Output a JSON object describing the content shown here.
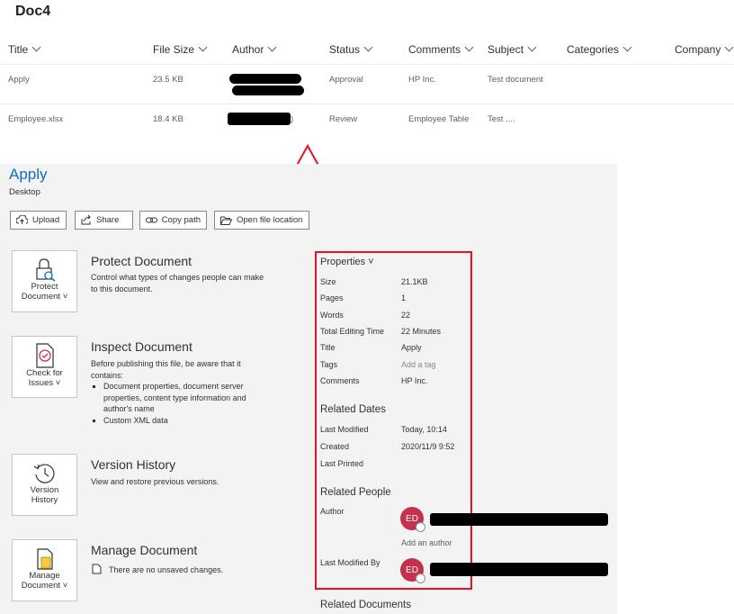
{
  "doc_title": "Doc4",
  "columns": [
    "Title",
    "File Size",
    "Author",
    "Status",
    "Comments",
    "Subject",
    "Categories",
    "Company"
  ],
  "rows": [
    {
      "title": "Apply",
      "size": "23.5 KB",
      "status": "Approval",
      "comments": "HP Inc.",
      "subject": "Test document"
    },
    {
      "title": "Employee.xlsx",
      "size": "18.4 KB",
      "author_tail": ")",
      "status": "Review",
      "comments": "Employee Table",
      "subject": "Test ...."
    }
  ],
  "info": {
    "title": "Apply",
    "location": "Desktop",
    "buttons": {
      "upload": "Upload",
      "share": "Share",
      "copy_path": "Copy path",
      "open_location": "Open file location"
    }
  },
  "sections": {
    "protect": {
      "tile_line1": "Protect",
      "tile_line2": "Document",
      "heading": "Protect Document",
      "desc": "Control what types of changes people can make to this document."
    },
    "inspect": {
      "tile_line1": "Check for",
      "tile_line2": "Issues",
      "heading": "Inspect Document",
      "desc": "Before publishing this file, be aware that it contains:",
      "bullets": [
        "Document properties, document server properties, content type information and author's name",
        "Custom XML data"
      ]
    },
    "version": {
      "tile_line1": "Version",
      "tile_line2": "History",
      "heading": "Version History",
      "desc": "View and restore previous versions."
    },
    "manage": {
      "tile_line1": "Manage",
      "tile_line2": "Document",
      "heading": "Manage Document",
      "desc": "There are no unsaved changes."
    }
  },
  "properties": {
    "heading": "Properties",
    "items": [
      {
        "label": "Size",
        "value": "21.1KB"
      },
      {
        "label": "Pages",
        "value": "1"
      },
      {
        "label": "Words",
        "value": "22"
      },
      {
        "label": "Total Editing Time",
        "value": "22 Minutes"
      },
      {
        "label": "Title",
        "value": "Apply"
      },
      {
        "label": "Tags",
        "value": "Add a tag"
      },
      {
        "label": "Comments",
        "value": "HP Inc."
      }
    ],
    "related_dates": {
      "heading": "Related Dates",
      "items": [
        {
          "label": "Last Modified",
          "value": "Today, 10:14"
        },
        {
          "label": "Created",
          "value": "2020/11/9 9:52"
        },
        {
          "label": "Last Printed",
          "value": ""
        }
      ]
    },
    "related_people": {
      "heading": "Related People",
      "author_label": "Author",
      "author_initials": "ED",
      "add_author": "Add an author",
      "last_modified_label": "Last Modified By",
      "last_modified_initials": "ED"
    },
    "related_documents": "Related Documents"
  },
  "colors": {
    "accent": "#0f6cbd",
    "highlight": "#e81123",
    "avatar": "#c4314b"
  }
}
